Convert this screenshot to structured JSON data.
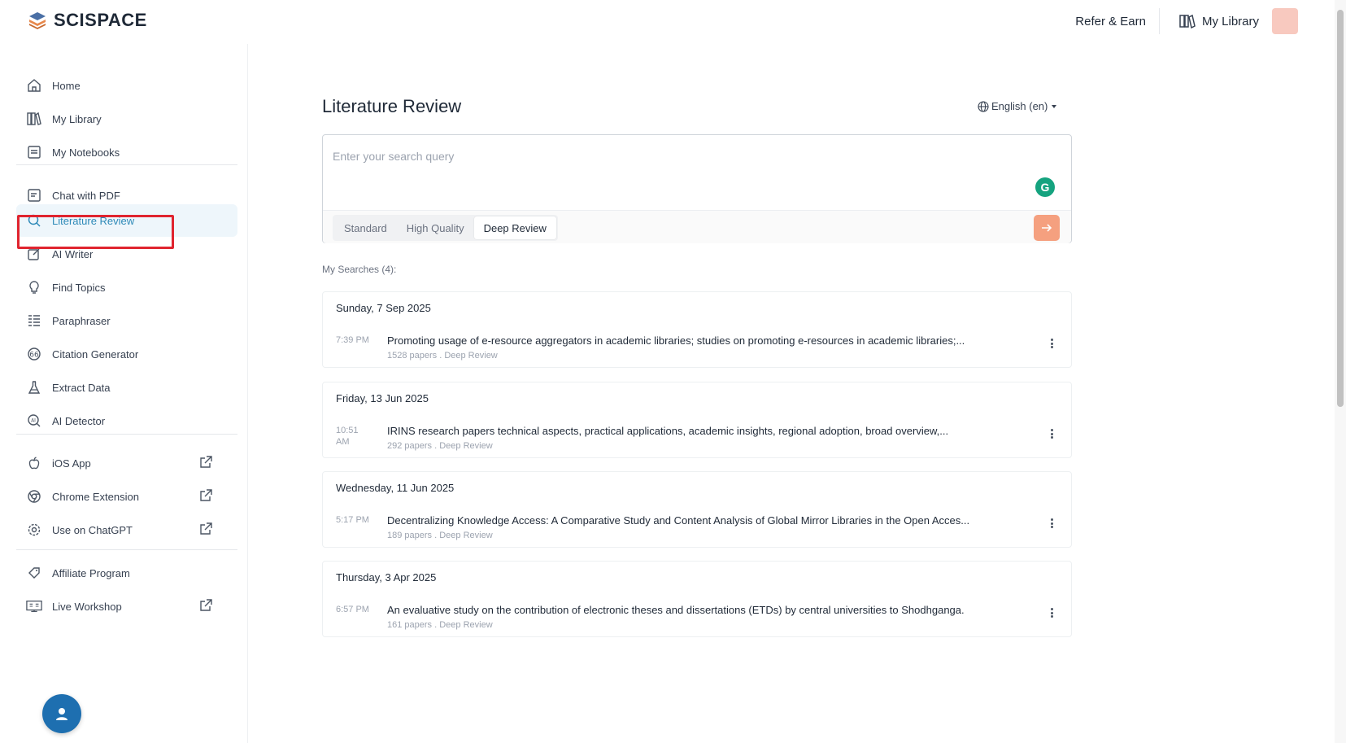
{
  "brand": {
    "name": "SCISPACE"
  },
  "topbar": {
    "refer_label": "Refer & Earn",
    "library_label": "My Library"
  },
  "sidebar": {
    "items": [
      {
        "label": "Home",
        "icon": "home-icon"
      },
      {
        "label": "My Library",
        "icon": "library-icon"
      },
      {
        "label": "My Notebooks",
        "icon": "notebook-icon"
      },
      {
        "label": "Chat with PDF",
        "icon": "chat-pdf-icon"
      },
      {
        "label": "Literature Review",
        "icon": "search-icon",
        "active": true
      },
      {
        "label": "AI Writer",
        "icon": "pen-icon"
      },
      {
        "label": "Find Topics",
        "icon": "bulb-icon"
      },
      {
        "label": "Paraphraser",
        "icon": "list-icon"
      },
      {
        "label": "Citation Generator",
        "icon": "quote-icon"
      },
      {
        "label": "Extract Data",
        "icon": "flask-icon"
      },
      {
        "label": "AI Detector",
        "icon": "ai-detector-icon"
      },
      {
        "label": "iOS App",
        "icon": "apple-icon",
        "external": true
      },
      {
        "label": "Chrome Extension",
        "icon": "chrome-icon",
        "external": true
      },
      {
        "label": "Use on ChatGPT",
        "icon": "chatgpt-icon",
        "external": true
      },
      {
        "label": "Affiliate Program",
        "icon": "affiliate-icon"
      },
      {
        "label": "Live Workshop",
        "icon": "workshop-icon",
        "external": true
      }
    ]
  },
  "main": {
    "title": "Literature Review",
    "language": "English (en)",
    "search": {
      "placeholder": "Enter your search query",
      "value": ""
    },
    "modes": [
      "Standard",
      "High Quality",
      "Deep Review"
    ],
    "selected_mode": "Deep Review",
    "my_searches_label": "My Searches (4):",
    "groups": [
      {
        "date": "Sunday, 7 Sep 2025",
        "time": "7:39 PM",
        "title": "Promoting usage of e-resource aggregators in academic libraries; studies on promoting e-resources in academic libraries;...",
        "meta": "1528 papers . Deep Review"
      },
      {
        "date": "Friday, 13 Jun 2025",
        "time": "10:51 AM",
        "title": "IRINS research papers technical aspects, practical applications, academic insights, regional adoption, broad overview,...",
        "meta": "292 papers . Deep Review"
      },
      {
        "date": "Wednesday, 11 Jun 2025",
        "time": "5:17 PM",
        "title": "Decentralizing Knowledge Access: A Comparative Study and Content Analysis of Global Mirror Libraries in the Open Acces...",
        "meta": "189 papers . Deep Review"
      },
      {
        "date": "Thursday, 3 Apr 2025",
        "time": "6:57 PM",
        "title": "An evaluative study on the contribution of electronic theses and dissertations (ETDs) by central universities to Shodhganga.",
        "meta": "161 papers . Deep Review"
      }
    ]
  },
  "colors": {
    "accent": "#2e8ab8",
    "submit": "#f5a07f",
    "highlight": "#e0242f",
    "help": "#1e6fb0"
  }
}
